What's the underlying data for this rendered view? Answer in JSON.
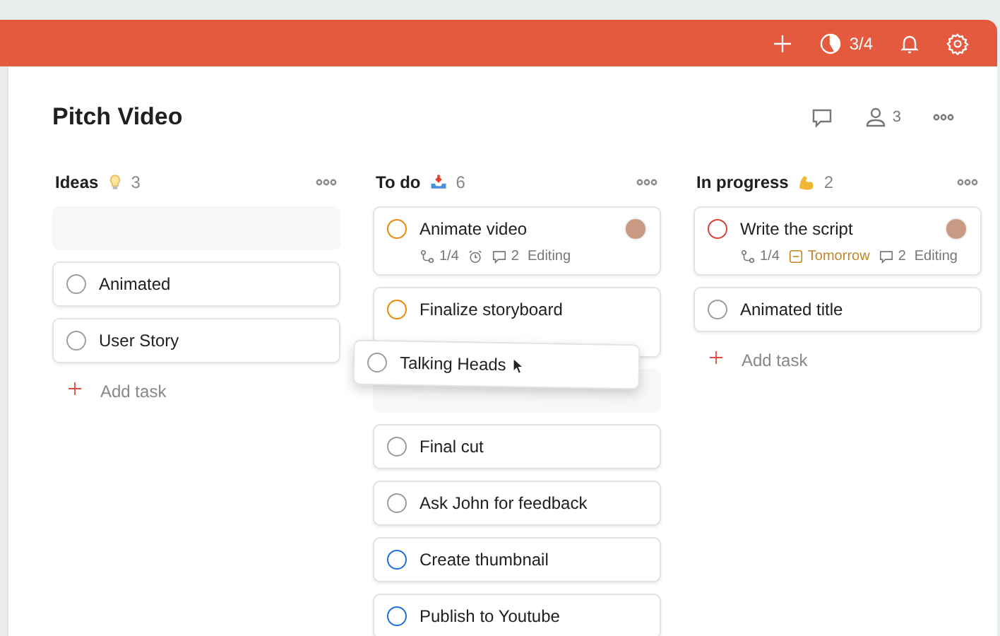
{
  "topbar": {
    "karma": "3/4"
  },
  "project": {
    "title": "Pitch Video",
    "members": "3"
  },
  "columns": [
    {
      "title": "Ideas",
      "kind": "bulb",
      "count": "3",
      "add_label": "Add task",
      "cards": [
        {
          "kind": "placeholder"
        },
        {
          "kind": "task",
          "title": "Animated",
          "color": "#9e9e9e"
        },
        {
          "kind": "task",
          "title": "User Story",
          "color": "#9e9e9e"
        }
      ]
    },
    {
      "title": "To do",
      "kind": "tray",
      "count": "6",
      "cards": [
        {
          "kind": "task",
          "title": "Animate video",
          "color": "#eb8909",
          "avatar": true,
          "meta": [
            {
              "kind": "subtasks",
              "text": "1/4"
            },
            {
              "kind": "alarm"
            },
            {
              "kind": "comments",
              "text": "2"
            },
            {
              "kind": "label",
              "text": "Editing"
            }
          ]
        },
        {
          "kind": "task",
          "title": "Finalize storyboard",
          "color": "#eb8909",
          "tall": true
        },
        {
          "kind": "placeholder"
        },
        {
          "kind": "task",
          "title": "Final cut",
          "color": "#9e9e9e"
        },
        {
          "kind": "task",
          "title": "Ask John for feedback",
          "color": "#9e9e9e"
        },
        {
          "kind": "task",
          "title": "Create thumbnail",
          "color": "#246fe0"
        },
        {
          "kind": "task",
          "title": "Publish to Youtube",
          "color": "#246fe0"
        }
      ]
    },
    {
      "title": "In progress",
      "kind": "arm",
      "count": "2",
      "add_label": "Add task",
      "cards": [
        {
          "kind": "task",
          "title": "Write the script",
          "color": "#d1453b",
          "avatar": true,
          "meta": [
            {
              "kind": "subtasks",
              "text": "1/4"
            },
            {
              "kind": "due",
              "text": "Tomorrow"
            },
            {
              "kind": "comments",
              "text": "2"
            },
            {
              "kind": "label",
              "text": "Editing"
            }
          ]
        },
        {
          "kind": "task",
          "title": "Animated title",
          "color": "#9e9e9e"
        }
      ]
    }
  ],
  "dragged": {
    "title": "Talking Heads",
    "color": "#9e9e9e"
  }
}
